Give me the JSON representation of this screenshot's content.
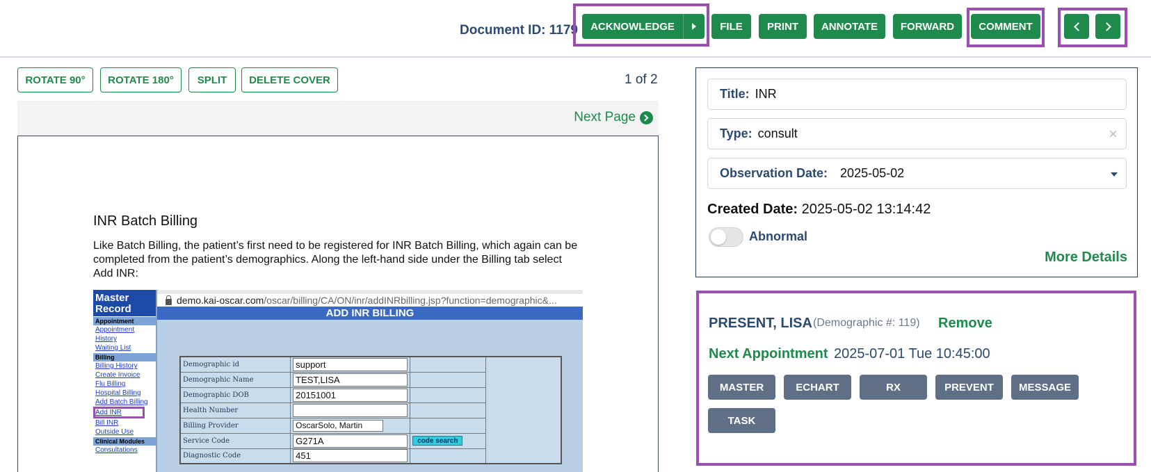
{
  "toolbar": {
    "document_id_label": "Document ID: 1179",
    "acknowledge_label": "ACKNOWLEDGE",
    "file_label": "FILE",
    "print_label": "PRINT",
    "annotate_label": "ANNOTATE",
    "forward_label": "FORWARD",
    "comment_label": "COMMENT"
  },
  "viewer": {
    "rotate90_label": "ROTATE 90°",
    "rotate180_label": "ROTATE 180°",
    "split_label": "SPLIT",
    "delete_cover_label": "DELETE COVER",
    "page_count": "1 of 2",
    "next_page_label": "Next Page"
  },
  "document": {
    "heading": "INR Batch Billing",
    "paragraph": "Like Batch Billing, the patient’s first need to be registered for INR Batch Billing, which again can be completed from the patient’s demographics.  Along the left-hand side under the Billing tab select Add INR:",
    "screenshot": {
      "sidebar_title": "Master Record",
      "sections": [
        {
          "title": "Appointment",
          "links": [
            "Appointment History",
            "Waiting List"
          ]
        },
        {
          "title": "Billing",
          "links": [
            "Billing History",
            "Create Invoice",
            "Flu Billing",
            "Hospital Billing",
            "Add Batch Billing",
            "Add INR",
            "Bill INR",
            "Outside Use"
          ]
        },
        {
          "title": "Clinical Modules",
          "links": [
            "Consultations"
          ]
        }
      ],
      "url_host": "demo.kai-oscar.com",
      "url_path": "/oscar/billing/CA/ON/inr/addINRbilling.jsp?function=demographic&...",
      "page_title": "ADD INR BILLING",
      "fields": [
        {
          "label": "Demographic id",
          "value": "support"
        },
        {
          "label": "Demographic Name",
          "value": "TEST,LISA"
        },
        {
          "label": "Demographic DOB",
          "value": "20151001"
        },
        {
          "label": "Health Number",
          "value": ""
        },
        {
          "label": "Billing Provider",
          "value": "OscarSolo, Martin"
        },
        {
          "label": "Service Code",
          "value": "G271A"
        },
        {
          "label": "Diagnostic Code",
          "value": "451"
        }
      ],
      "code_search_label": "code search"
    }
  },
  "metadata": {
    "title_label": "Title:",
    "title_value": "INR",
    "type_label": "Type:",
    "type_value": "consult",
    "observation_label": "Observation Date:",
    "observation_value": "2025-05-02",
    "created_label": "Created Date:",
    "created_value": "2025-05-02 13:14:42",
    "abnormal_label": "Abnormal",
    "abnormal_on": false,
    "more_details_label": "More Details"
  },
  "patient": {
    "name": "PRESENT, LISA",
    "demographic": "(Demographic #: 119)",
    "remove_label": "Remove",
    "next_appt_label": "Next Appointment",
    "next_appt_value": "2025-07-01 Tue 10:45:00",
    "buttons": [
      "MASTER",
      "ECHART",
      "RX",
      "PREVENT",
      "MESSAGE",
      "TASK"
    ]
  },
  "colors": {
    "primary_green": "#1e8a4c",
    "highlight_purple": "#9b4fb0",
    "slate_button": "#5e6f86",
    "navy_text": "#2c4a70"
  }
}
